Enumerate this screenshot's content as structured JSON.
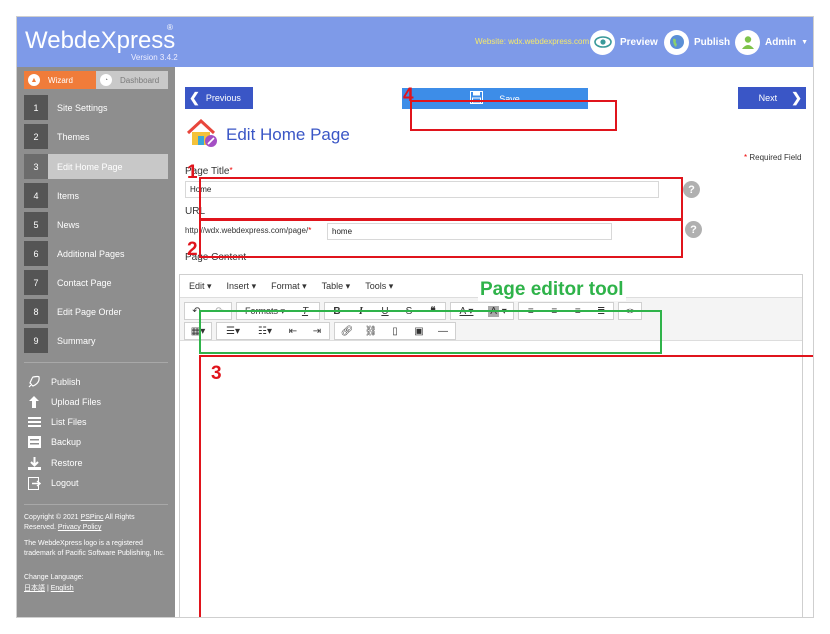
{
  "header": {
    "logo_text": "WebdeXpress",
    "logo_reg": "®",
    "version": "Version 3.4.2",
    "website": "Website: wdx.webdexpress.com",
    "preview_label": "Preview",
    "publish_label": "Publish",
    "admin_label": "Admin"
  },
  "sidebar": {
    "tab_wizard": "Wizard",
    "tab_dashboard": "Dashboard",
    "steps": [
      {
        "num": "1",
        "label": "Site Settings"
      },
      {
        "num": "2",
        "label": "Themes"
      },
      {
        "num": "3",
        "label": "Edit Home Page"
      },
      {
        "num": "4",
        "label": "Items"
      },
      {
        "num": "5",
        "label": "News"
      },
      {
        "num": "6",
        "label": "Additional Pages"
      },
      {
        "num": "7",
        "label": "Contact Page"
      },
      {
        "num": "8",
        "label": "Edit Page Order"
      },
      {
        "num": "9",
        "label": "Summary"
      }
    ],
    "utils": [
      {
        "label": "Publish",
        "icon": "rocket-icon"
      },
      {
        "label": "Upload Files",
        "icon": "upload-icon"
      },
      {
        "label": "List Files",
        "icon": "list-icon"
      },
      {
        "label": "Backup",
        "icon": "backup-icon"
      },
      {
        "label": "Restore",
        "icon": "restore-icon"
      },
      {
        "label": "Logout",
        "icon": "logout-icon"
      }
    ],
    "copyright_prefix": "Copyright © 2021 ",
    "copyright_link": "PSPinc",
    "copyright_suffix": " All Rights Reserved. ",
    "privacy_link": "Privacy Policy",
    "trademark": "The WebdeXpress logo is a registered trademark of Pacific Software Publishing, Inc.",
    "change_language": "Change Language:",
    "lang_japanese": "日本語",
    "lang_sep": "|",
    "lang_english": "English"
  },
  "main": {
    "previous_label": "Previous",
    "save_label": "Save",
    "next_label": "Next",
    "page_heading": "Edit Home Page",
    "required_note": "Required Field",
    "page_title_label": "Page Title",
    "page_title_value": "Home",
    "url_label": "URL",
    "url_prefix": "http://wdx.webdexpress.com/page/",
    "url_value": "home",
    "content_label": "Page Content",
    "help_glyph": "?",
    "star": "*"
  },
  "editor": {
    "menus": [
      "Edit",
      "Insert",
      "Format",
      "Table",
      "Tools"
    ],
    "formats_label": "Formats"
  },
  "annotations": {
    "n1": "1",
    "n2": "2",
    "n3": "3",
    "n4": "4",
    "editor_tool_label": "Page editor tool"
  },
  "colors": {
    "header_bg": "#7e9ae8",
    "accent_blue": "#3a56c6",
    "save_blue": "#3d8de8",
    "wizard_orange": "#f07c3a",
    "annotation_red": "#e0141c",
    "annotation_green": "#2fb34a"
  }
}
